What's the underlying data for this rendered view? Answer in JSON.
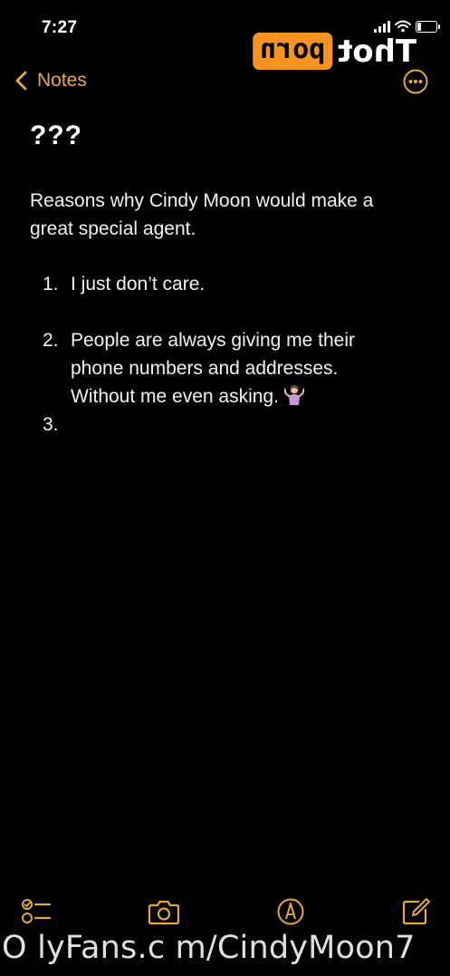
{
  "status_bar": {
    "time": "7:27",
    "icons": [
      "signal-icon",
      "wifi-icon",
      "battery-icon"
    ]
  },
  "watermark_logo": {
    "box_text": "porn",
    "text": "Thot"
  },
  "nav": {
    "back_label": "Notes",
    "more_icon": "ellipsis-circle-icon"
  },
  "note": {
    "title": "???",
    "intro": "Reasons why Cindy Moon would make a great special agent.",
    "items": [
      {
        "number": "1.",
        "text": "I just don’t care."
      },
      {
        "number": "2.",
        "text": "People are always giving me their phone numbers and addresses. Without me even asking."
      },
      {
        "number": "3.",
        "text": ""
      }
    ]
  },
  "toolbar": {
    "items": [
      "checklist-icon",
      "camera-icon",
      "markup-pen-icon",
      "compose-icon"
    ]
  },
  "bottom_watermark": "O lyFans.c m/CindyMoon7",
  "colors": {
    "accent": "#e4a83b",
    "background": "#000000",
    "watermark_orange": "#f79420"
  }
}
